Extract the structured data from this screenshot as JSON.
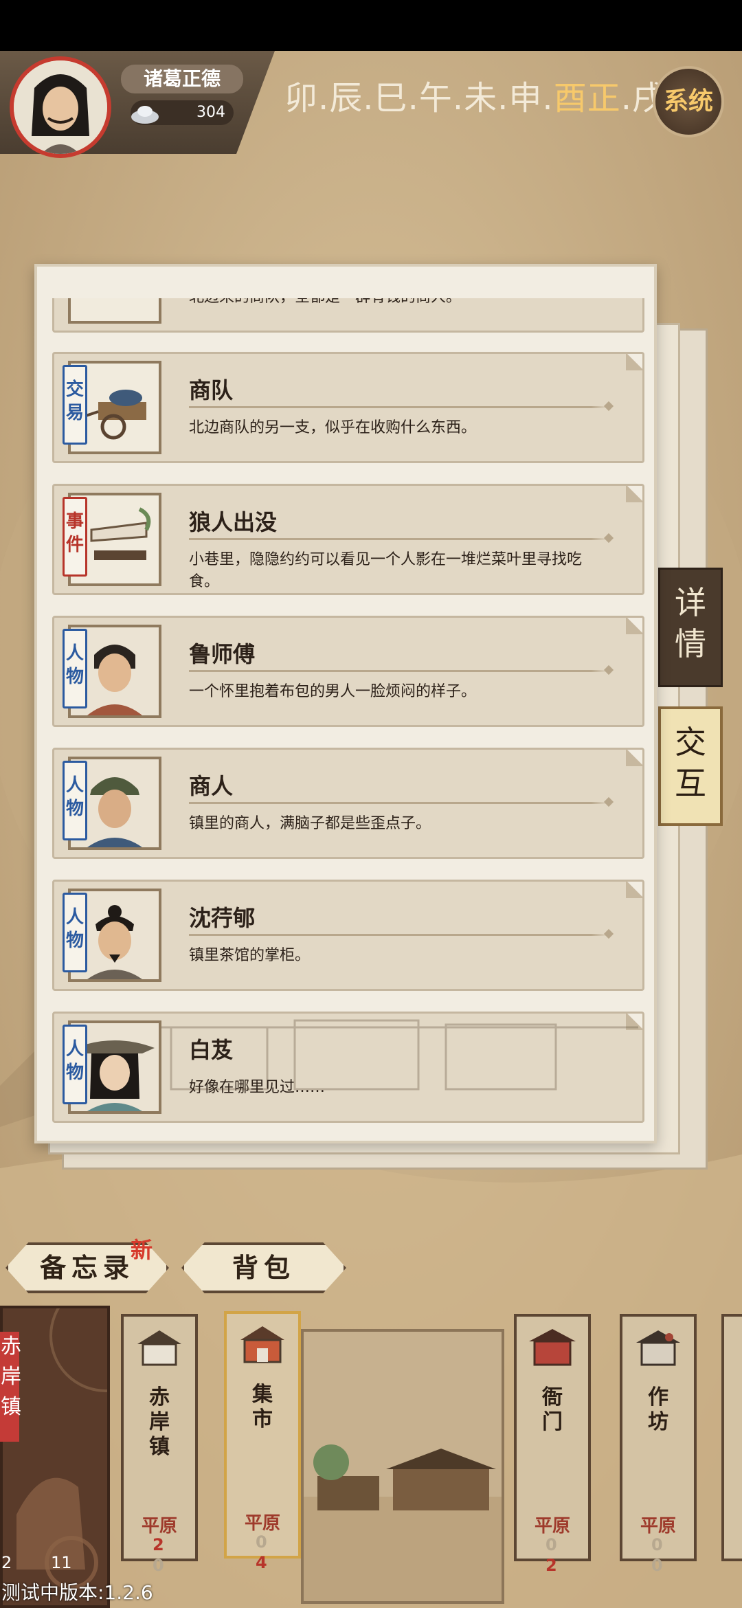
{
  "player": {
    "name": "诸葛正德",
    "coins": "304"
  },
  "time_bar": {
    "segments": [
      "卯",
      "辰",
      "巳",
      "午",
      "未",
      "申",
      "酉正",
      "戌"
    ],
    "current": "酉正"
  },
  "system_button": "系统",
  "side_tabs": {
    "detail": "详情",
    "interact": "交互"
  },
  "cards": [
    {
      "tag": "",
      "title": "",
      "desc": "北边来的商队，全都是一群有钱的商人。",
      "partial": true
    },
    {
      "tag": "交易",
      "tag_color": "#2b5aa0",
      "title": "商队",
      "desc": "北边商队的另一支，似乎在收购什么东西。"
    },
    {
      "tag": "事件",
      "tag_color": "#b7342a",
      "title": "狼人出没",
      "desc": "小巷里，隐隐约约可以看见一个人影在一堆烂菜叶里寻找吃食。"
    },
    {
      "tag": "人物",
      "tag_color": "#2b5aa0",
      "title": "鲁师傅",
      "desc": "一个怀里抱着布包的男人一脸烦闷的样子。"
    },
    {
      "tag": "人物",
      "tag_color": "#2b5aa0",
      "title": "商人",
      "desc": "镇里的商人，满脑子都是些歪点子。"
    },
    {
      "tag": "人物",
      "tag_color": "#2b5aa0",
      "title": "沈荇郇",
      "desc": "镇里茶馆的掌柜。"
    },
    {
      "tag": "人物",
      "tag_color": "#2b5aa0",
      "title": "白芨",
      "desc": "好像在哪里见过……"
    }
  ],
  "bottom_tabs": {
    "memo": "备忘录",
    "bag": "背包",
    "new_badge": "新"
  },
  "current_location": {
    "name_vertical": "赤岸镇",
    "count_left": "2",
    "count_right": "11"
  },
  "locations": [
    {
      "name": "赤岸镇",
      "terrain": "平原",
      "stat1": "2",
      "stat2": "0"
    },
    {
      "name": "集市",
      "terrain": "平原",
      "stat1": "0",
      "stat2": "4",
      "selected": true
    },
    {
      "name": "衙门",
      "terrain": "平原",
      "stat1": "0",
      "stat2": "2"
    },
    {
      "name": "作坊",
      "terrain": "平原",
      "stat1": "0",
      "stat2": "0"
    }
  ],
  "version": "测试中版本:1.2.6",
  "colors": {
    "accent_gold": "#f7c96b",
    "accent_red": "#c63b2f",
    "tag_blue": "#2b5aa0",
    "tag_red": "#b7342a"
  }
}
